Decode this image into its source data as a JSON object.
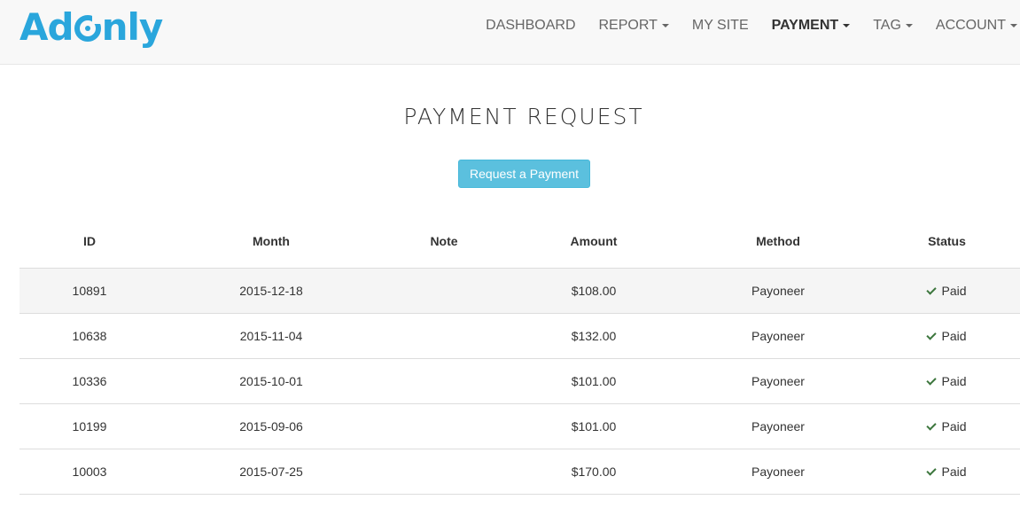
{
  "brand": {
    "logo_before": "Ad",
    "logo_after": "nly",
    "logo_ring_letter": "O",
    "color": "#2aa6dc"
  },
  "nav": {
    "items": [
      {
        "label": "DASHBOARD",
        "dropdown": false,
        "active": false
      },
      {
        "label": "REPORT",
        "dropdown": true,
        "active": false
      },
      {
        "label": "MY SITE",
        "dropdown": false,
        "active": false
      },
      {
        "label": "PAYMENT",
        "dropdown": true,
        "active": true
      },
      {
        "label": "TAG",
        "dropdown": true,
        "active": false
      },
      {
        "label": "ACCOUNT",
        "dropdown": true,
        "active": false
      }
    ]
  },
  "page": {
    "title": "PAYMENT REQUEST",
    "request_button": "Request a Payment"
  },
  "table": {
    "headers": [
      "ID",
      "Month",
      "Note",
      "Amount",
      "Method",
      "Status"
    ],
    "rows": [
      {
        "id": "10891",
        "month": "2015-12-18",
        "note": "",
        "amount": "$108.00",
        "method": "Payoneer",
        "status": "Paid"
      },
      {
        "id": "10638",
        "month": "2015-11-04",
        "note": "",
        "amount": "$132.00",
        "method": "Payoneer",
        "status": "Paid"
      },
      {
        "id": "10336",
        "month": "2015-10-01",
        "note": "",
        "amount": "$101.00",
        "method": "Payoneer",
        "status": "Paid"
      },
      {
        "id": "10199",
        "month": "2015-09-06",
        "note": "",
        "amount": "$101.00",
        "method": "Payoneer",
        "status": "Paid"
      },
      {
        "id": "10003",
        "month": "2015-07-25",
        "note": "",
        "amount": "$170.00",
        "method": "Payoneer",
        "status": "Paid"
      }
    ]
  },
  "icons": {
    "status_paid": "check-icon",
    "dropdown": "caret-down-icon"
  },
  "colors": {
    "amount": "#a94442",
    "status_paid": "#3c763d",
    "button": "#5bc0de"
  }
}
